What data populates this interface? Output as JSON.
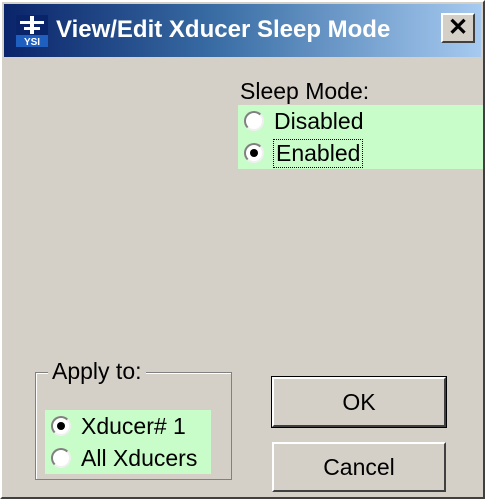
{
  "window": {
    "title": "View/Edit Xducer Sleep Mode",
    "app_icon_text": "YSI",
    "close_label": "✕"
  },
  "sleep_mode": {
    "label": "Sleep Mode:",
    "options": [
      {
        "label": "Disabled",
        "checked": false
      },
      {
        "label": "Enabled",
        "checked": true
      }
    ]
  },
  "apply_to": {
    "label": "Apply to:",
    "options": [
      {
        "label": "Xducer# 1",
        "checked": true
      },
      {
        "label": "All Xducers",
        "checked": false
      }
    ]
  },
  "buttons": {
    "ok": "OK",
    "cancel": "Cancel"
  },
  "colors": {
    "radio_highlight": "#c8fcc8",
    "dialog_face": "#d4d0c8",
    "titlebar_start": "#0a246a"
  }
}
